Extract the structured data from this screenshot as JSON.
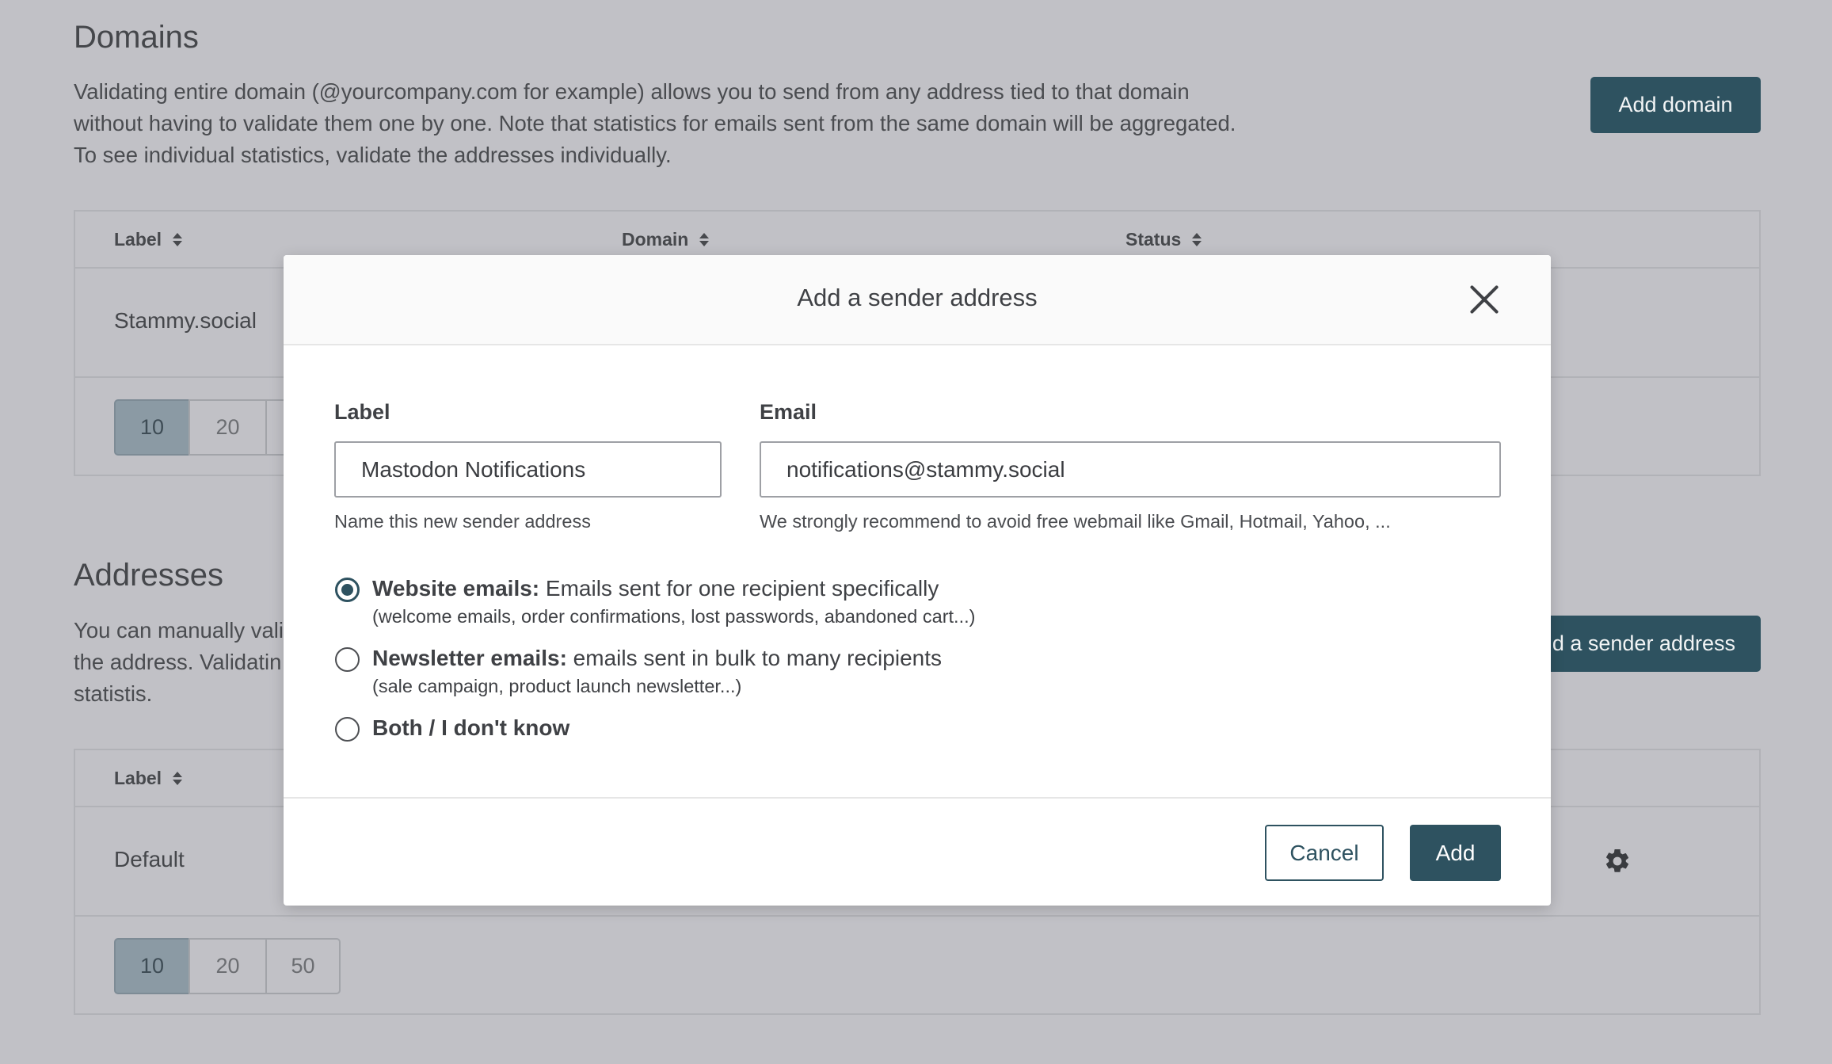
{
  "domains": {
    "title": "Domains",
    "description_lines": [
      "Validating entire domain (@yourcompany.com for example) allows you to send from any address tied to that domain",
      "without having to validate them one by one. Note that statistics for emails sent from the same domain will be aggregated.",
      "To see individual statistics, validate the addresses individually."
    ],
    "add_button": "Add domain",
    "columns": [
      "Label",
      "Domain",
      "Status"
    ],
    "rows": [
      {
        "label": "Stammy.social"
      }
    ],
    "page_sizes": [
      "10",
      "20"
    ]
  },
  "addresses": {
    "title": "Addresses",
    "description_lines": [
      "You can manually vali",
      "the address. Validatin",
      "statistis."
    ],
    "add_button": "d a sender address",
    "columns": [
      "Label"
    ],
    "rows": [
      {
        "label": "Default"
      }
    ],
    "page_sizes": [
      "10",
      "20",
      "50"
    ]
  },
  "modal": {
    "title": "Add a sender address",
    "label_field": {
      "label": "Label",
      "value": "Mastodon Notifications",
      "help": "Name this new sender address"
    },
    "email_field": {
      "label": "Email",
      "value": "notifications@stammy.social",
      "help": "We strongly recommend to avoid free webmail like Gmail, Hotmail, Yahoo, ..."
    },
    "options": [
      {
        "bold": "Website emails:",
        "text": " Emails sent for one recipient specifically",
        "sub": "(welcome emails, order confirmations, lost passwords, abandoned cart...)",
        "checked": true
      },
      {
        "bold": "Newsletter emails:",
        "text": " emails sent in bulk to many recipients",
        "sub": "(sale campaign, product launch newsletter...)",
        "checked": false
      },
      {
        "bold": "Both / I don't know",
        "text": "",
        "sub": "",
        "checked": false
      }
    ],
    "cancel_label": "Cancel",
    "add_label": "Add"
  },
  "icons": {
    "close": "close-icon",
    "sort": "sort-icon",
    "settings": "gear-icon"
  },
  "colors": {
    "accent": "#2e5260",
    "overlay_bg": "#c1c1c6",
    "active_page": "#8b9aa4"
  }
}
